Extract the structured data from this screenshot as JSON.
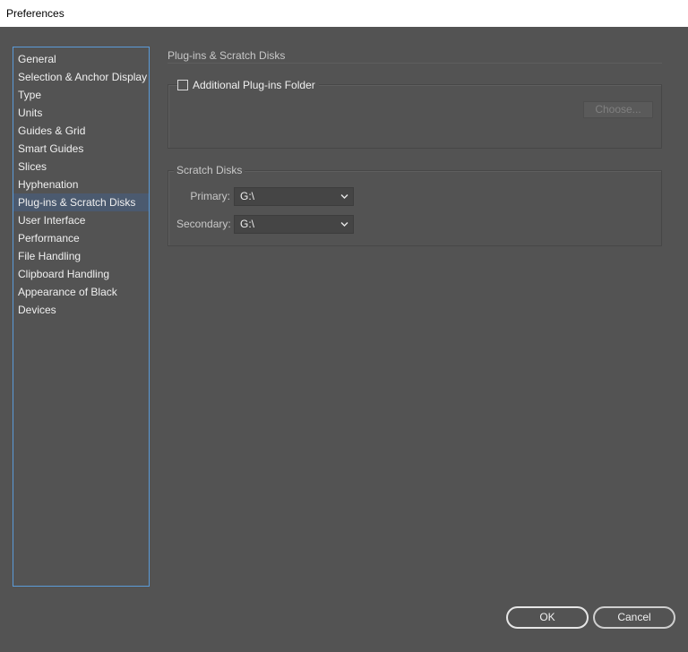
{
  "window": {
    "title": "Preferences"
  },
  "sidebar": {
    "items": [
      {
        "label": "General"
      },
      {
        "label": "Selection & Anchor Display"
      },
      {
        "label": "Type"
      },
      {
        "label": "Units"
      },
      {
        "label": "Guides & Grid"
      },
      {
        "label": "Smart Guides"
      },
      {
        "label": "Slices"
      },
      {
        "label": "Hyphenation"
      },
      {
        "label": "Plug-ins & Scratch Disks",
        "selected": true
      },
      {
        "label": "User Interface"
      },
      {
        "label": "Performance"
      },
      {
        "label": "File Handling"
      },
      {
        "label": "Clipboard Handling"
      },
      {
        "label": "Appearance of Black"
      },
      {
        "label": "Devices"
      }
    ]
  },
  "main": {
    "section_title": "Plug-ins & Scratch Disks",
    "plugins": {
      "checkbox_label": "Additional Plug-ins Folder",
      "checked": false,
      "choose_label": "Choose..."
    },
    "scratch": {
      "legend": "Scratch Disks",
      "primary_label": "Primary:",
      "primary_value": "G:\\",
      "secondary_label": "Secondary:",
      "secondary_value": "G:\\"
    }
  },
  "footer": {
    "ok_label": "OK",
    "cancel_label": "Cancel"
  },
  "icons": {
    "dropdown": "chevron-down-icon"
  },
  "colors": {
    "background": "#535353",
    "selection": "#4b5a6f",
    "list_border": "#5b9bd8"
  }
}
